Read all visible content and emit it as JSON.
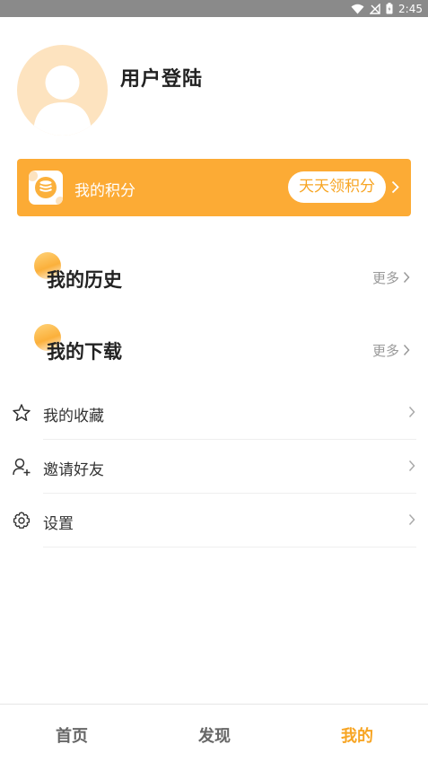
{
  "status_bar": {
    "time": "2:45"
  },
  "profile": {
    "login_label": "用户登陆"
  },
  "points": {
    "label": "我的积分",
    "cta": "天天领积分"
  },
  "history": {
    "title": "我的历史",
    "more": "更多"
  },
  "downloads": {
    "title": "我的下载",
    "more": "更多"
  },
  "menu": [
    {
      "label": "我的收藏",
      "icon": "star-icon"
    },
    {
      "label": "邀请好友",
      "icon": "user-plus-icon"
    },
    {
      "label": "设置",
      "icon": "gear-icon"
    }
  ],
  "tabs": [
    {
      "label": "首页",
      "active": false
    },
    {
      "label": "发现",
      "active": false
    },
    {
      "label": "我的",
      "active": true
    }
  ],
  "colors": {
    "accent": "#fcab35",
    "accent_text": "#f7a524",
    "avatar_bg": "#fde3bf"
  }
}
